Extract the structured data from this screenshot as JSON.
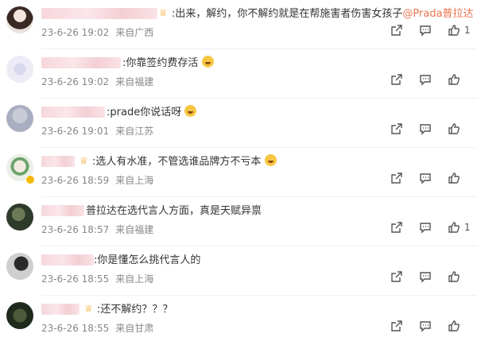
{
  "comments": [
    {
      "text_pre": ":出来，解约，你不解约就是在帮施害者伤害女孩子",
      "mention": "@Prada普拉达",
      "time": "23-6-26 19:02",
      "source": "来自广西",
      "likes": "1"
    },
    {
      "text_pre": ":你靠签约费存活",
      "mention": "",
      "time": "23-6-26 19:02",
      "source": "来自福建",
      "likes": ""
    },
    {
      "text_pre": ":prade你说话呀",
      "mention": "",
      "time": "23-6-26 19:01",
      "source": "来自江苏",
      "likes": ""
    },
    {
      "text_pre": ":选人有水准，不管选谁品牌方不亏本",
      "mention": "",
      "time": "23-6-26 18:59",
      "source": "来自上海",
      "likes": ""
    },
    {
      "text_pre": "普拉达在选代言人方面，真是天赋异禀",
      "mention": "",
      "time": "23-6-26 18:57",
      "source": "来自福建",
      "likes": "1"
    },
    {
      "text_pre": ":你是懂怎么挑代言人的",
      "mention": "",
      "time": "23-6-26 18:55",
      "source": "来自上海",
      "likes": ""
    },
    {
      "text_pre": ":还不解约？？？",
      "mention": "",
      "time": "23-6-26 18:55",
      "source": "来自甘肃",
      "likes": ""
    }
  ]
}
